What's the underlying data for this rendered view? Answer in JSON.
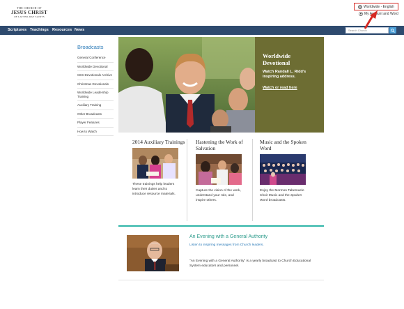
{
  "header": {
    "logo": {
      "line1": "THE CHURCH OF",
      "line2": "JESUS CHRIST",
      "line3": "OF LATTER-DAY SAINTS"
    },
    "language_label": "Worldwide - English",
    "account_label": "My Account and Word"
  },
  "nav": {
    "items": [
      "Scriptures",
      "Teachings",
      "Resources",
      "News"
    ],
    "search_placeholder": "Search Church",
    "color": "#2e4a6e"
  },
  "sidebar": {
    "title": "Broadcasts",
    "links": [
      "General Conference",
      "Worldwide Devotional",
      "CES Devotionals Archive",
      "Christmas Devotionals",
      "Worldwide Leadership Training",
      "Auxiliary Training",
      "Other Broadcasts",
      "Player Features",
      "How to Watch"
    ]
  },
  "hero": {
    "heading": "Worldwide Devotional",
    "text": "Watch Randall L. Ridd's inspiring address.",
    "link": "Watch or read here",
    "panel_color": "#6d6d33"
  },
  "columns": [
    {
      "heading": "2014 Auxiliary Trainings",
      "text": "These trainings help leaders learn their duties and to introduce resource materials."
    },
    {
      "heading": "Hastening the Work of Salvation",
      "text": "Capture the vision of the work, understand your role, and inspire others."
    },
    {
      "heading": "Music and the Spoken Word",
      "text_parts": [
        "Enjoy the Mormon Tabernacle Choir Music and the ",
        "Spoken Word",
        " broadcasts."
      ]
    }
  ],
  "evening": {
    "heading": "An Evening with a General Authority",
    "subtitle": "Listen to inspiring messages from Church leaders.",
    "text": "\"An Evening with a General Authority\" is a yearly broadcast to Church Educational System educators and personnel."
  },
  "colors": {
    "accent_teal": "#2fb5a8",
    "link_blue": "#2a7ab8",
    "highlight_red": "#d52a23"
  }
}
